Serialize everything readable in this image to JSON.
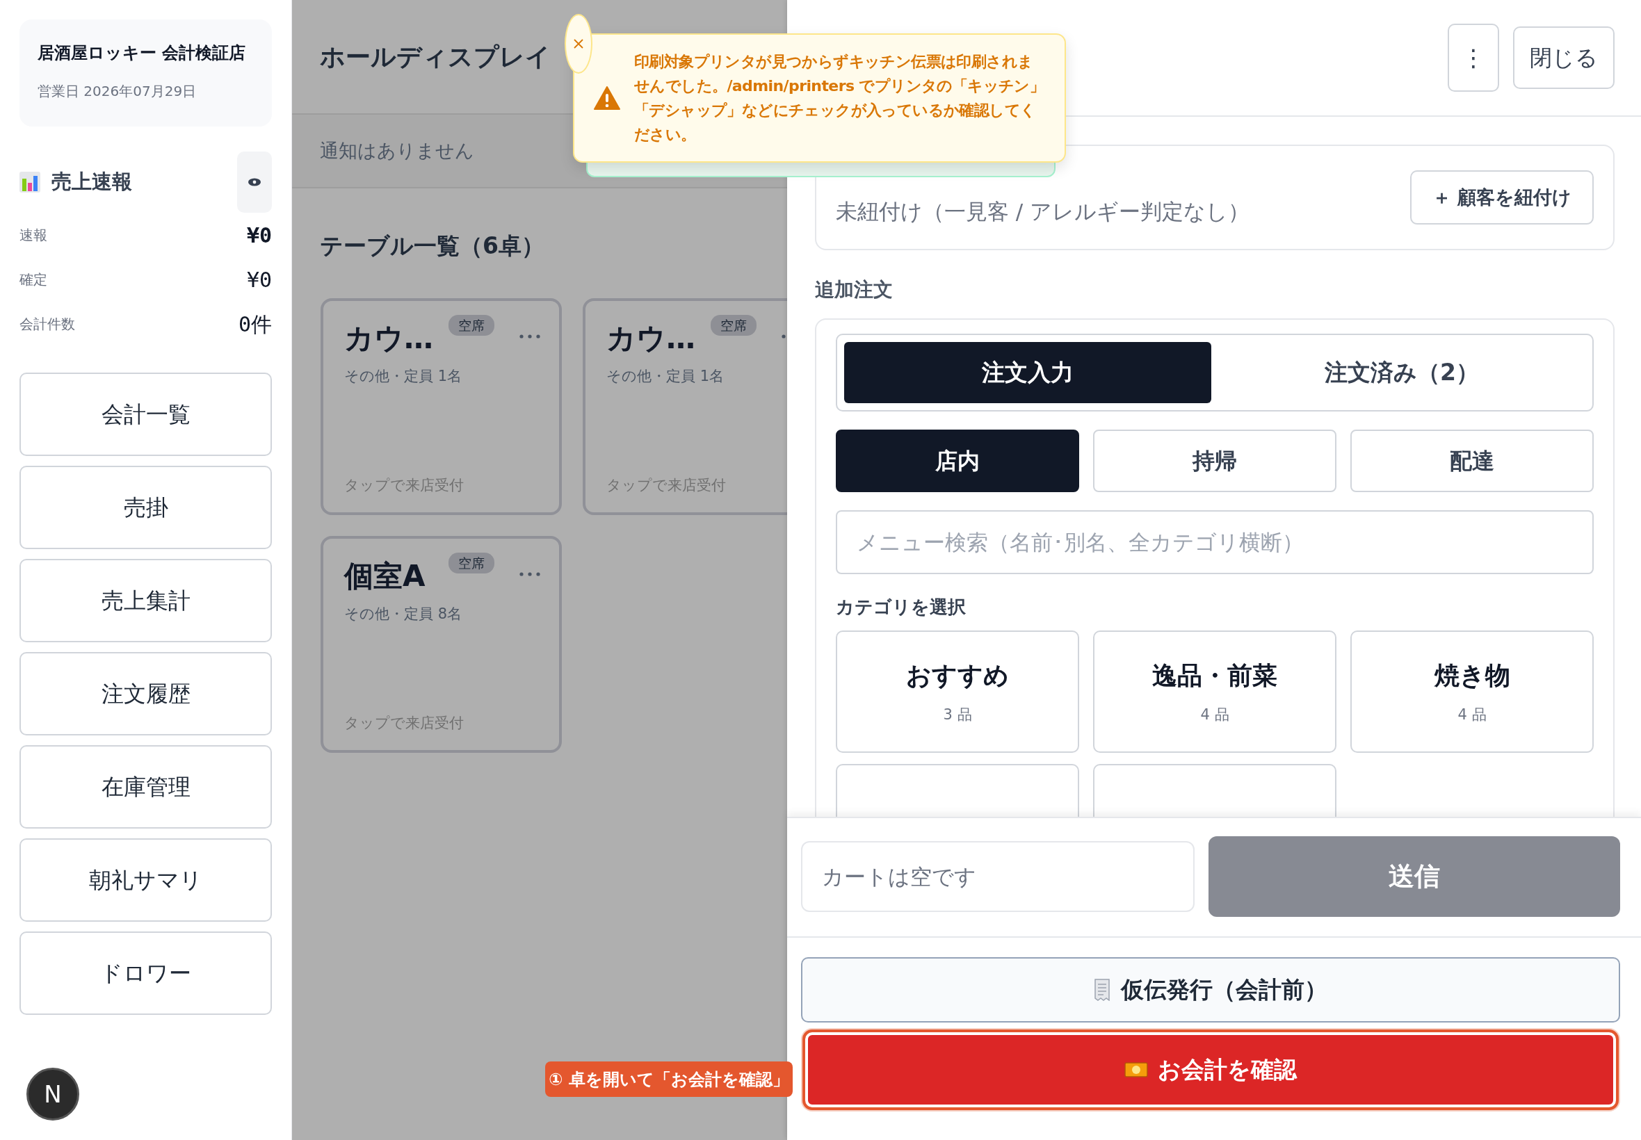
{
  "sidebar": {
    "store_name": "居酒屋ロッキー 会計検証店",
    "business_date": "営業日 2026年07月29日",
    "sales_title": "売上速報",
    "stats": [
      {
        "label": "速報",
        "value": "¥0",
        "kind": "primary"
      },
      {
        "label": "確定",
        "value": "¥0",
        "kind": "normal"
      },
      {
        "label": "会計件数",
        "value": "0件",
        "kind": "normal"
      }
    ],
    "nav": [
      "会計一覧",
      "売掛",
      "売上集計",
      "注文履歴",
      "在庫管理",
      "朝礼サマリ",
      "ドロワー"
    ],
    "avatar": "N"
  },
  "hall": {
    "title": "ホールディスプレイ",
    "notice": "通知はありません",
    "tables_heading": "テーブル一覧（6卓）",
    "tables": [
      {
        "name": "カウ…",
        "status": "空席",
        "detail": "その他・定員 1名",
        "hint": "タップで来店受付"
      },
      {
        "name": "カウ…",
        "status": "空席",
        "detail": "その他・定員 1名",
        "hint": "タップで来店受付"
      },
      {
        "name": "個室A",
        "status": "空席",
        "detail": "その他・定員 8名",
        "hint": "タップで来店受付"
      }
    ],
    "guide_badge": "① 卓を開いて「お会計を確認」"
  },
  "toast": {
    "kind": "warning",
    "message": "印刷対象プリンタが見つからずキッチン伝票は印刷されませんでした。/admin/printers でプリンタの「キッチン」「デシャップ」などにチェックが入っているか確認してください。"
  },
  "panel": {
    "more_button": "⋮",
    "close_button": "閉じる",
    "customer": {
      "value": "未紐付け（一見客 / アレルギー判定なし）",
      "button": "＋ 顧客を紐付け"
    },
    "add_order_heading": "追加注文",
    "order_tabs": [
      {
        "label": "注文入力",
        "selected": true
      },
      {
        "label": "注文済み（2）",
        "selected": false
      }
    ],
    "order_types": [
      {
        "label": "店内",
        "selected": true
      },
      {
        "label": "持帰",
        "selected": false
      },
      {
        "label": "配達",
        "selected": false
      }
    ],
    "search": {
      "placeholder": "メニュー検索（名前･別名、全カテゴリ横断）"
    },
    "category_heading": "カテゴリを選択",
    "categories": [
      {
        "name": "おすすめ",
        "count": "3 品"
      },
      {
        "name": "逸品・前菜",
        "count": "4 品"
      },
      {
        "name": "焼き物",
        "count": "4 品"
      }
    ],
    "cart": {
      "placeholder": "カートは空です"
    },
    "send": {
      "label": "送信",
      "disabled": true
    },
    "provisional_button": "仮伝発行（会計前）",
    "checkout_button": "お会計を確認"
  }
}
